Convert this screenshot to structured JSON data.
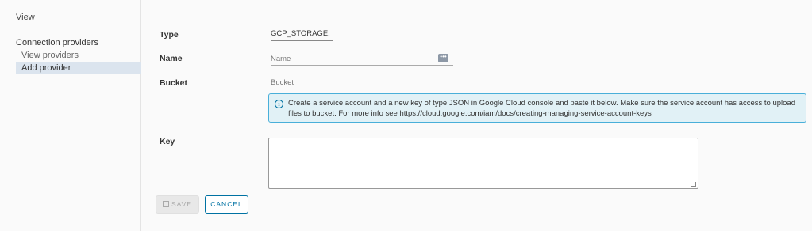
{
  "sidebar": {
    "view_label": "View",
    "section_title": "Connection providers",
    "items": [
      {
        "label": "View providers"
      },
      {
        "label": "Add provider"
      }
    ]
  },
  "form": {
    "type_label": "Type",
    "type_value": "GCP_STORAGE",
    "name_label": "Name",
    "name_placeholder": "Name",
    "bucket_label": "Bucket",
    "bucket_placeholder": "Bucket",
    "info_text": "Create a service account and a new key of type JSON in Google Cloud console and paste it below. Make sure the service account has access to upload files to bucket. For more info see https://cloud.google.com/iam/docs/creating-managing-service-account-keys",
    "key_label": "Key",
    "key_value": ""
  },
  "buttons": {
    "save_label": "SAVE",
    "cancel_label": "CANCEL"
  },
  "colors": {
    "accent": "#0072a3",
    "info_bg": "#e1f1f6",
    "info_border": "#49afd9",
    "selected_nav": "#dbe4ee"
  },
  "icons": {
    "type_dropdown": "chevron-down-icon",
    "name_action": "more-icon",
    "info": "info-icon",
    "save": "save-icon"
  }
}
